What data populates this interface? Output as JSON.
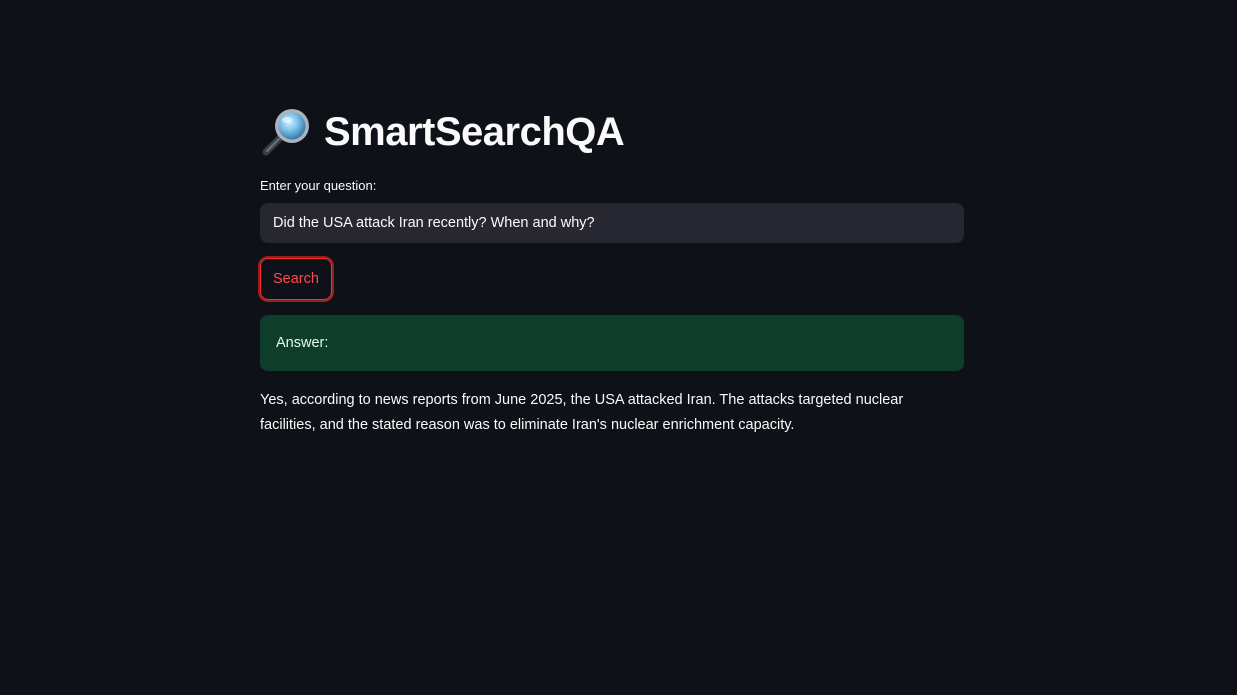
{
  "app": {
    "title": "SmartSearchQA",
    "title_icon": "magnifying-glass-icon"
  },
  "question": {
    "label": "Enter your question:",
    "value": "Did the USA attack Iran recently? When and why?"
  },
  "search_button": {
    "label": "Search"
  },
  "answer": {
    "label": "Answer:",
    "text": "Yes, according to news reports from June 2025, the USA attacked Iran. The attacks targeted nuclear facilities, and the stated reason was to eliminate Iran's nuclear enrichment capacity."
  },
  "colors": {
    "background": "#0e1117",
    "input_background": "#262730",
    "accent": "#ff4b4b",
    "answer_background": "#0e3e2b",
    "answer_text": "#dffde9",
    "text": "#fafafa"
  }
}
